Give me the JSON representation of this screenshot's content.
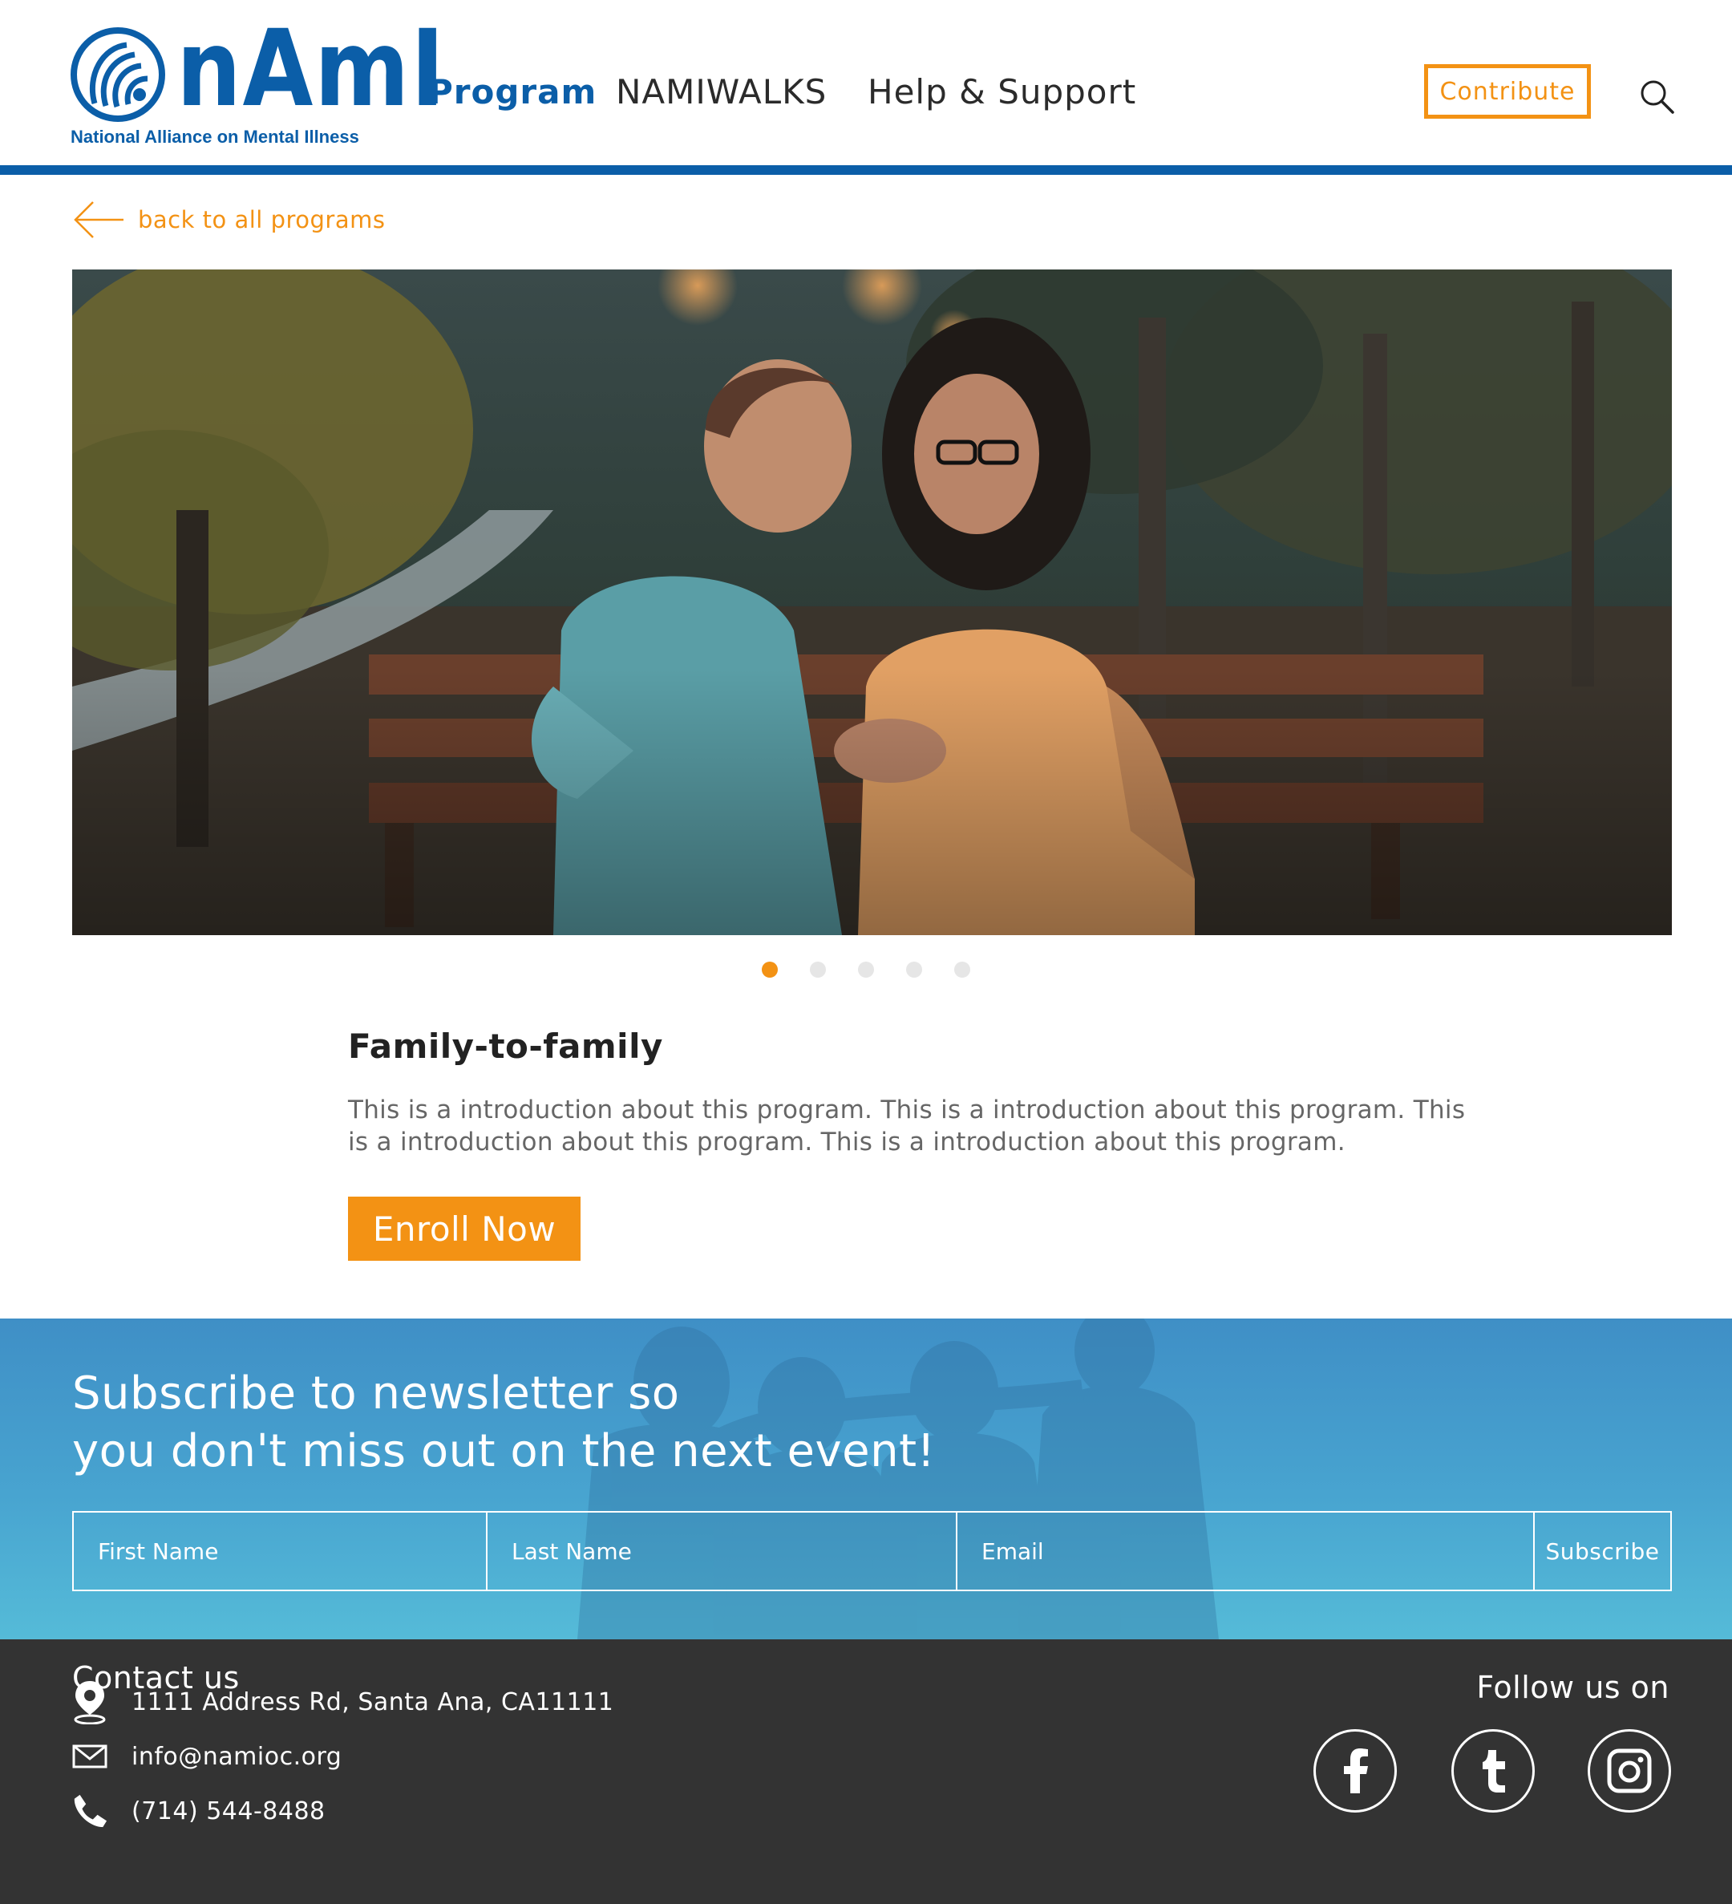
{
  "brand": {
    "name": "nAmI",
    "tagline": "National Alliance on Mental Illness",
    "primary_color": "#0b5ea8",
    "accent_color": "#f39214"
  },
  "nav": {
    "items": [
      {
        "label": "Program",
        "active": true
      },
      {
        "label": "NAMIWALKS",
        "active": false
      },
      {
        "label": "Help & Support",
        "active": false
      }
    ],
    "contribute_label": "Contribute",
    "search_icon": "search-icon"
  },
  "back_link": {
    "label": "back to all programs",
    "icon": "arrow-left-icon"
  },
  "hero": {
    "image_description": "photo",
    "carousel_count": 5,
    "carousel_active_index": 0
  },
  "program": {
    "title": "Family-to-family",
    "description": "This is a introduction about this program. This is a introduction about this program. This is a introduction about this program. This is a introduction about this program.",
    "enroll_label": "Enroll Now"
  },
  "newsletter": {
    "title_line1": "Subscribe to newsletter so",
    "title_line2": "you don't miss out on the next event!",
    "first_name_placeholder": "First Name",
    "last_name_placeholder": "Last Name",
    "email_placeholder": "Email",
    "subscribe_label": "Subscribe"
  },
  "footer": {
    "contact_title": "Contact us",
    "address": "1111 Address Rd, Santa Ana, CA11111",
    "email": "info@namioc.org",
    "phone": "(714) 544-8488",
    "follow_label": "Follow us on",
    "social": [
      "facebook-icon",
      "tumblr-icon",
      "instagram-icon"
    ]
  }
}
